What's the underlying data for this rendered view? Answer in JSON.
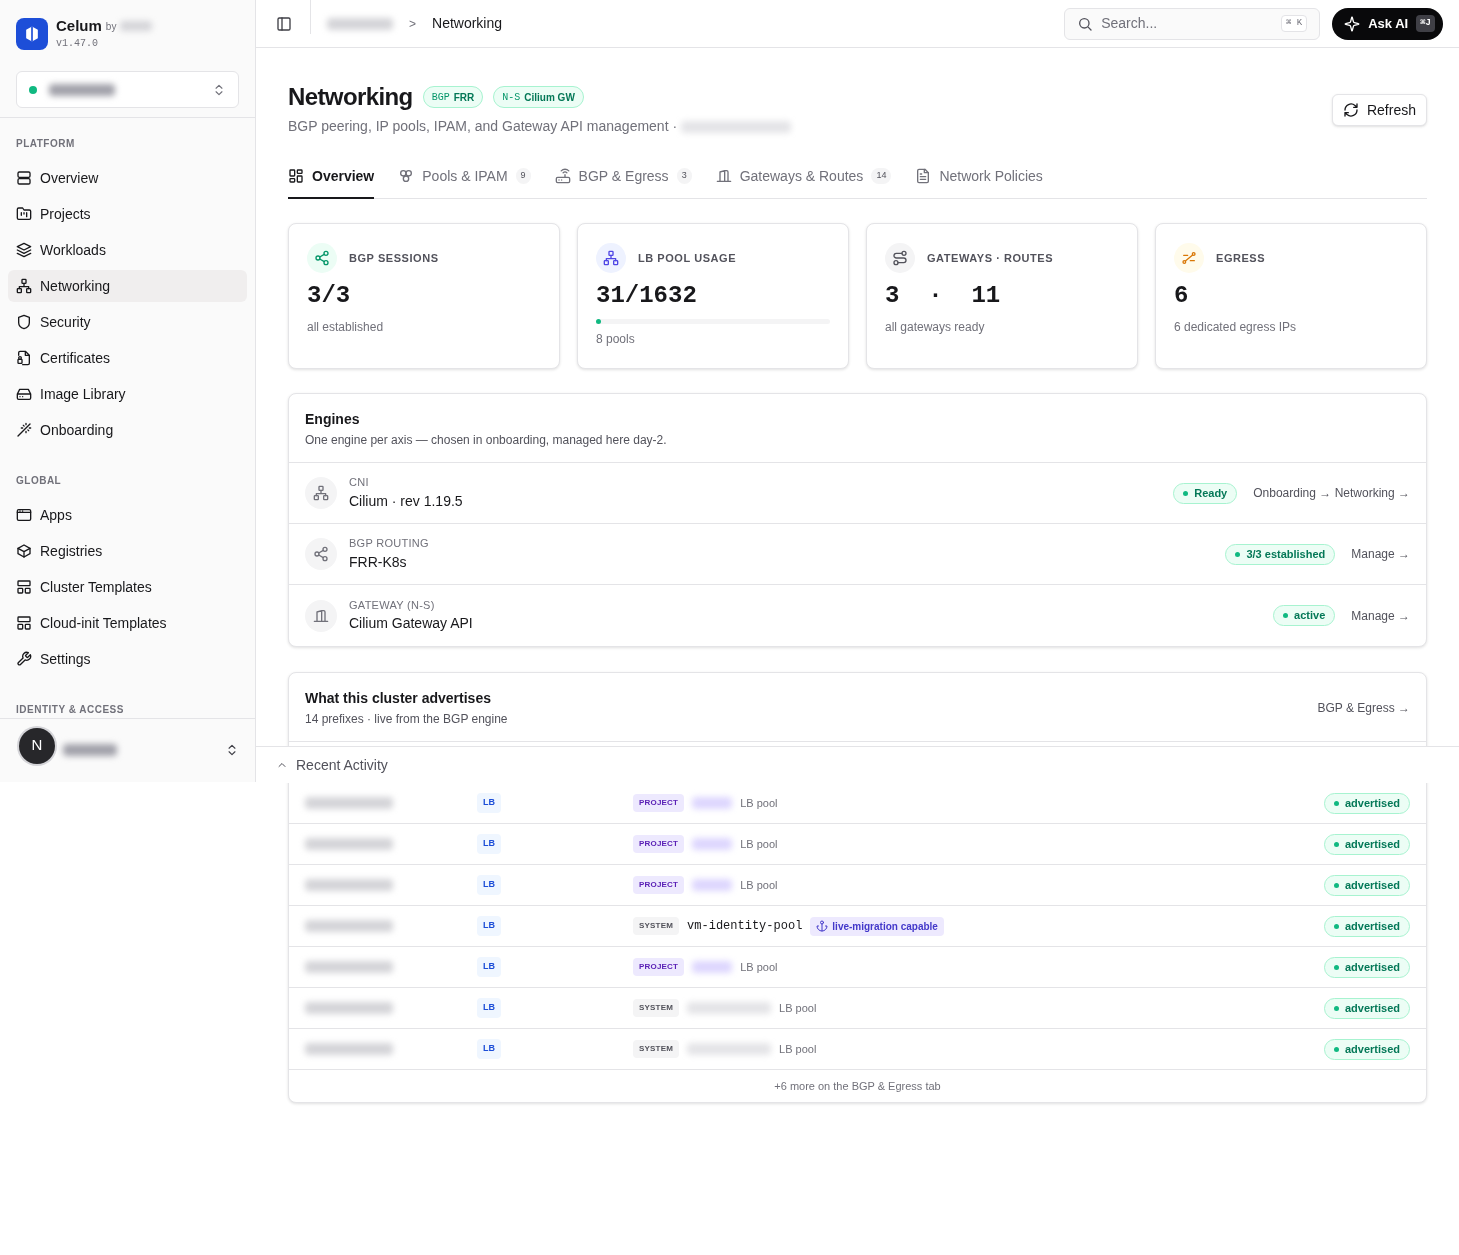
{
  "sidebar": {
    "brand": "Celum",
    "by": "by",
    "version": "v1.47.0",
    "cluster": {
      "color": "#10b981"
    },
    "sections": [
      {
        "title": "PLATFORM",
        "items": [
          {
            "label": "Overview",
            "selected": false
          },
          {
            "label": "Projects",
            "selected": false
          },
          {
            "label": "Workloads",
            "selected": false
          },
          {
            "label": "Networking",
            "selected": true
          },
          {
            "label": "Security",
            "selected": false
          },
          {
            "label": "Certificates",
            "selected": false
          },
          {
            "label": "Image Library",
            "selected": false
          },
          {
            "label": "Onboarding",
            "selected": false
          }
        ]
      },
      {
        "title": "GLOBAL",
        "items": [
          {
            "label": "Apps",
            "selected": false
          },
          {
            "label": "Registries",
            "selected": false
          },
          {
            "label": "Cluster Templates",
            "selected": false
          },
          {
            "label": "Cloud-init Templates",
            "selected": false
          },
          {
            "label": "Settings",
            "selected": false
          }
        ]
      },
      {
        "title": "IDENTITY & ACCESS"
      }
    ],
    "user": {
      "avatar": "N"
    }
  },
  "header": {
    "separator": ">",
    "breadcrumb_current": "Networking",
    "search": {
      "placeholder": "Search...",
      "shortcut": "⌘ K"
    },
    "ask_ai": {
      "label": "Ask AI",
      "shortcut": "⌘J"
    }
  },
  "page": {
    "title": "Networking",
    "badges": [
      {
        "prefix": "BGP",
        "value": "FRR"
      },
      {
        "prefix": "N-S",
        "value": "Cilium GW"
      }
    ],
    "subtitle": "BGP peering, IP pools, IPAM, and Gateway API management ·",
    "refresh": "Refresh"
  },
  "tabs": [
    {
      "label": "Overview",
      "selected": true
    },
    {
      "label": "Pools & IPAM",
      "count": "9",
      "selected": false
    },
    {
      "label": "BGP & Egress",
      "count": "3",
      "selected": false
    },
    {
      "label": "Gateways & Routes",
      "count": "14",
      "selected": false
    },
    {
      "label": "Network Policies",
      "selected": false
    }
  ],
  "stats": [
    {
      "kind": "share",
      "label": "BGP SESSIONS",
      "value": "3/3",
      "note": "all established"
    },
    {
      "kind": "pool",
      "label": "LB POOL USAGE",
      "value": "31/1632",
      "level": 0.019,
      "note": "8 pools"
    },
    {
      "kind": "gateway",
      "label": "GATEWAYS · ROUTES",
      "value": "3  ·  11",
      "note": "all gateways ready"
    },
    {
      "kind": "egress",
      "label": "EGRESS",
      "value": "6",
      "note": "6 dedicated egress IPs"
    }
  ],
  "engines": {
    "title": "Engines",
    "subtitle": "One engine per axis — chosen in onboarding, managed here day-2.",
    "rows": [
      {
        "kind": "cni",
        "axis": "CNI",
        "name": "Cilium · rev 1.19.5",
        "status": "Ready",
        "link": "Onboarding → Networking →"
      },
      {
        "kind": "bgp",
        "axis": "BGP ROUTING",
        "name": "FRR-K8s",
        "status": "3/3 established",
        "link": "Manage →"
      },
      {
        "kind": "gateway",
        "axis": "GATEWAY (N-S)",
        "name": "Cilium Gateway API",
        "status": "active",
        "link": "Manage →"
      }
    ]
  },
  "advertises": {
    "title": "What this cluster advertises",
    "subtitle": "14 prefixes · live from the BGP engine",
    "link": "BGP & Egress →",
    "rows": [
      {
        "type": "LB",
        "scope": "PROJECT",
        "kind": "project",
        "note": "LB pool",
        "status": "advertised"
      },
      {
        "type": "LB",
        "scope": "PROJECT",
        "kind": "project",
        "note": "LB pool",
        "status": "advertised"
      },
      {
        "type": "LB",
        "scope": "PROJECT",
        "kind": "project",
        "note": "LB pool",
        "status": "advertised"
      },
      {
        "type": "LB",
        "scope": "SYSTEM",
        "kind": "system",
        "name": "vm-identity-pool",
        "badge": "live-migration capable",
        "status": "advertised"
      },
      {
        "type": "LB",
        "scope": "PROJECT",
        "kind": "project",
        "note": "LB pool",
        "status": "advertised"
      },
      {
        "type": "LB",
        "scope": "SYSTEM",
        "kind": "system",
        "note": "LB pool",
        "status": "advertised"
      },
      {
        "type": "LB",
        "scope": "SYSTEM",
        "kind": "system",
        "note": "LB pool",
        "status": "advertised"
      }
    ],
    "footer": "+6 more on the BGP & Egress tab"
  },
  "recent_activity": {
    "label": "Recent Activity",
    "expanded": false
  }
}
